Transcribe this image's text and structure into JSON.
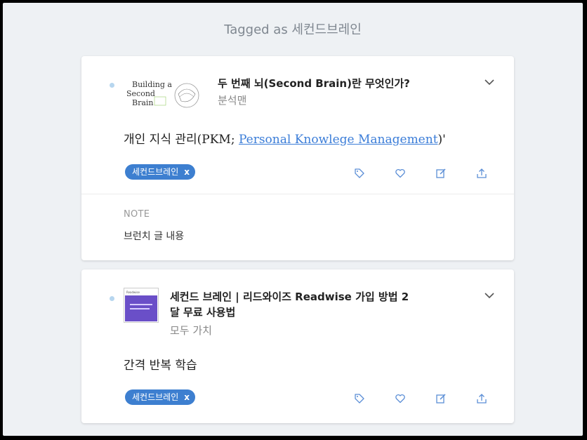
{
  "header": {
    "text": "Tagged as 세컨드브레인"
  },
  "cards": [
    {
      "title": "두 번째 뇌(Second Brain)란 무엇인가?",
      "author": "분석맨",
      "thumb_text": "Building a Second Brain",
      "quote_prefix": "개인 지식 관리(PKM; ",
      "quote_link": "Personal Knowlege Management",
      "quote_suffix": ")'",
      "tag": "세컨드브레인",
      "tag_remove": "x",
      "note_label": "NOTE",
      "note_text": "브런치 글 내용"
    },
    {
      "title_line1": "세컨드 브레인 | 리드와이즈 Readwise 가입 방법 2",
      "title_line2": "달 무료 사용법",
      "author": "모두 가치",
      "thumb_text": "Readwise",
      "quote": "간격 반복 학습",
      "tag": "세컨드브레인",
      "tag_remove": "x"
    }
  ],
  "colors": {
    "accent": "#3d7fd0",
    "link": "#3b7dd8",
    "icon": "#5b8ed6",
    "background": "#eef1f4"
  },
  "icons": [
    "tag-icon",
    "heart-icon",
    "edit-icon",
    "share-icon",
    "chevron-down-icon"
  ]
}
